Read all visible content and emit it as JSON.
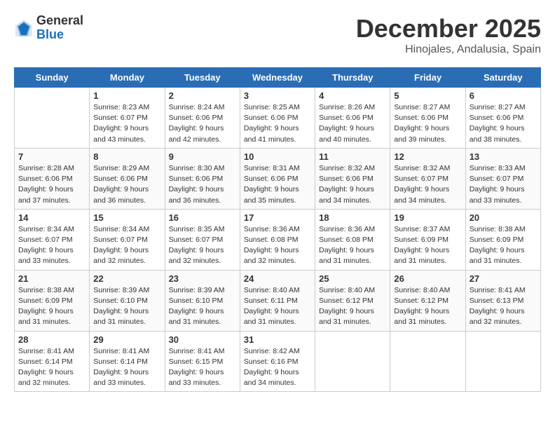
{
  "logo": {
    "text_general": "General",
    "text_blue": "Blue"
  },
  "header": {
    "month": "December 2025",
    "location": "Hinojales, Andalusia, Spain"
  },
  "days": [
    "Sunday",
    "Monday",
    "Tuesday",
    "Wednesday",
    "Thursday",
    "Friday",
    "Saturday"
  ],
  "weeks": [
    [
      {
        "date": "",
        "sunrise": "",
        "sunset": "",
        "daylight": ""
      },
      {
        "date": "1",
        "sunrise": "Sunrise: 8:23 AM",
        "sunset": "Sunset: 6:07 PM",
        "daylight": "Daylight: 9 hours and 43 minutes."
      },
      {
        "date": "2",
        "sunrise": "Sunrise: 8:24 AM",
        "sunset": "Sunset: 6:06 PM",
        "daylight": "Daylight: 9 hours and 42 minutes."
      },
      {
        "date": "3",
        "sunrise": "Sunrise: 8:25 AM",
        "sunset": "Sunset: 6:06 PM",
        "daylight": "Daylight: 9 hours and 41 minutes."
      },
      {
        "date": "4",
        "sunrise": "Sunrise: 8:26 AM",
        "sunset": "Sunset: 6:06 PM",
        "daylight": "Daylight: 9 hours and 40 minutes."
      },
      {
        "date": "5",
        "sunrise": "Sunrise: 8:27 AM",
        "sunset": "Sunset: 6:06 PM",
        "daylight": "Daylight: 9 hours and 39 minutes."
      },
      {
        "date": "6",
        "sunrise": "Sunrise: 8:27 AM",
        "sunset": "Sunset: 6:06 PM",
        "daylight": "Daylight: 9 hours and 38 minutes."
      }
    ],
    [
      {
        "date": "7",
        "sunrise": "Sunrise: 8:28 AM",
        "sunset": "Sunset: 6:06 PM",
        "daylight": "Daylight: 9 hours and 37 minutes."
      },
      {
        "date": "8",
        "sunrise": "Sunrise: 8:29 AM",
        "sunset": "Sunset: 6:06 PM",
        "daylight": "Daylight: 9 hours and 36 minutes."
      },
      {
        "date": "9",
        "sunrise": "Sunrise: 8:30 AM",
        "sunset": "Sunset: 6:06 PM",
        "daylight": "Daylight: 9 hours and 36 minutes."
      },
      {
        "date": "10",
        "sunrise": "Sunrise: 8:31 AM",
        "sunset": "Sunset: 6:06 PM",
        "daylight": "Daylight: 9 hours and 35 minutes."
      },
      {
        "date": "11",
        "sunrise": "Sunrise: 8:32 AM",
        "sunset": "Sunset: 6:06 PM",
        "daylight": "Daylight: 9 hours and 34 minutes."
      },
      {
        "date": "12",
        "sunrise": "Sunrise: 8:32 AM",
        "sunset": "Sunset: 6:07 PM",
        "daylight": "Daylight: 9 hours and 34 minutes."
      },
      {
        "date": "13",
        "sunrise": "Sunrise: 8:33 AM",
        "sunset": "Sunset: 6:07 PM",
        "daylight": "Daylight: 9 hours and 33 minutes."
      }
    ],
    [
      {
        "date": "14",
        "sunrise": "Sunrise: 8:34 AM",
        "sunset": "Sunset: 6:07 PM",
        "daylight": "Daylight: 9 hours and 33 minutes."
      },
      {
        "date": "15",
        "sunrise": "Sunrise: 8:34 AM",
        "sunset": "Sunset: 6:07 PM",
        "daylight": "Daylight: 9 hours and 32 minutes."
      },
      {
        "date": "16",
        "sunrise": "Sunrise: 8:35 AM",
        "sunset": "Sunset: 6:07 PM",
        "daylight": "Daylight: 9 hours and 32 minutes."
      },
      {
        "date": "17",
        "sunrise": "Sunrise: 8:36 AM",
        "sunset": "Sunset: 6:08 PM",
        "daylight": "Daylight: 9 hours and 32 minutes."
      },
      {
        "date": "18",
        "sunrise": "Sunrise: 8:36 AM",
        "sunset": "Sunset: 6:08 PM",
        "daylight": "Daylight: 9 hours and 31 minutes."
      },
      {
        "date": "19",
        "sunrise": "Sunrise: 8:37 AM",
        "sunset": "Sunset: 6:09 PM",
        "daylight": "Daylight: 9 hours and 31 minutes."
      },
      {
        "date": "20",
        "sunrise": "Sunrise: 8:38 AM",
        "sunset": "Sunset: 6:09 PM",
        "daylight": "Daylight: 9 hours and 31 minutes."
      }
    ],
    [
      {
        "date": "21",
        "sunrise": "Sunrise: 8:38 AM",
        "sunset": "Sunset: 6:09 PM",
        "daylight": "Daylight: 9 hours and 31 minutes."
      },
      {
        "date": "22",
        "sunrise": "Sunrise: 8:39 AM",
        "sunset": "Sunset: 6:10 PM",
        "daylight": "Daylight: 9 hours and 31 minutes."
      },
      {
        "date": "23",
        "sunrise": "Sunrise: 8:39 AM",
        "sunset": "Sunset: 6:10 PM",
        "daylight": "Daylight: 9 hours and 31 minutes."
      },
      {
        "date": "24",
        "sunrise": "Sunrise: 8:40 AM",
        "sunset": "Sunset: 6:11 PM",
        "daylight": "Daylight: 9 hours and 31 minutes."
      },
      {
        "date": "25",
        "sunrise": "Sunrise: 8:40 AM",
        "sunset": "Sunset: 6:12 PM",
        "daylight": "Daylight: 9 hours and 31 minutes."
      },
      {
        "date": "26",
        "sunrise": "Sunrise: 8:40 AM",
        "sunset": "Sunset: 6:12 PM",
        "daylight": "Daylight: 9 hours and 31 minutes."
      },
      {
        "date": "27",
        "sunrise": "Sunrise: 8:41 AM",
        "sunset": "Sunset: 6:13 PM",
        "daylight": "Daylight: 9 hours and 32 minutes."
      }
    ],
    [
      {
        "date": "28",
        "sunrise": "Sunrise: 8:41 AM",
        "sunset": "Sunset: 6:14 PM",
        "daylight": "Daylight: 9 hours and 32 minutes."
      },
      {
        "date": "29",
        "sunrise": "Sunrise: 8:41 AM",
        "sunset": "Sunset: 6:14 PM",
        "daylight": "Daylight: 9 hours and 33 minutes."
      },
      {
        "date": "30",
        "sunrise": "Sunrise: 8:41 AM",
        "sunset": "Sunset: 6:15 PM",
        "daylight": "Daylight: 9 hours and 33 minutes."
      },
      {
        "date": "31",
        "sunrise": "Sunrise: 8:42 AM",
        "sunset": "Sunset: 6:16 PM",
        "daylight": "Daylight: 9 hours and 34 minutes."
      },
      {
        "date": "",
        "sunrise": "",
        "sunset": "",
        "daylight": ""
      },
      {
        "date": "",
        "sunrise": "",
        "sunset": "",
        "daylight": ""
      },
      {
        "date": "",
        "sunrise": "",
        "sunset": "",
        "daylight": ""
      }
    ]
  ]
}
